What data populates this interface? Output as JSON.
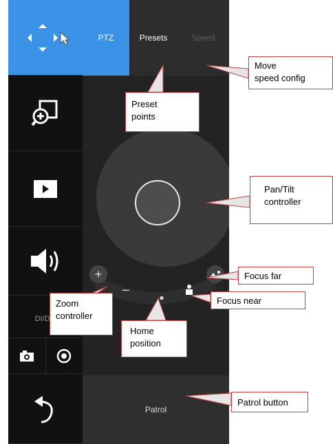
{
  "tabs": {
    "ptz": "PTZ",
    "presets": "Presets",
    "speed": "Speed"
  },
  "sidebar": {
    "dido_label": "DI/DO"
  },
  "patrol_label": "Patrol",
  "callouts": {
    "move_speed": [
      "Move",
      "speed config"
    ],
    "preset_points": [
      "Preset",
      "points"
    ],
    "pan_tilt": [
      "Pan/Tilt",
      "controller"
    ],
    "focus_far": "Focus far",
    "focus_near": "Focus near",
    "zoom_controller": [
      "Zoom",
      "controller"
    ],
    "home_position": [
      "Home",
      "position"
    ],
    "patrol_button": "Patrol button"
  },
  "colors": {
    "accent": "#3a93e6",
    "callout_border": "#c94040"
  },
  "icons": [
    "pan-tilt-arrows-icon",
    "cursor-icon",
    "digital-zoom-icon",
    "play-icon",
    "speaker-icon",
    "snapshot-camera-icon",
    "record-icon",
    "return-arrow-icon",
    "zoom-in-icon",
    "zoom-out-icon",
    "home-dot-icon",
    "focus-near-icon",
    "focus-far-icon"
  ]
}
